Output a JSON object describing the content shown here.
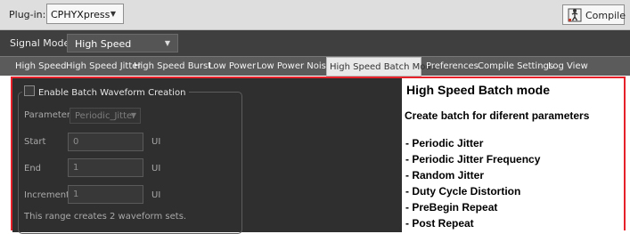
{
  "topbar": {
    "plugin_label": "Plug-in:",
    "plugin_value": "CPHYXpress",
    "compile_label": "Compile"
  },
  "signal": {
    "label": "Signal Mode:",
    "value": "High Speed"
  },
  "tabs": [
    "High Speed",
    "High Speed Jitter",
    "High Speed Burst",
    "Low Power",
    "Low Power Noise",
    "High Speed Batch Mode",
    "Preferences",
    "Compile Settings",
    "Log View"
  ],
  "active_tab_index": 5,
  "batch": {
    "enable_label": "Enable Batch Waveform Creation",
    "enabled": false,
    "parameter_label": "Parameter",
    "parameter_value": "Periodic_Jitter",
    "start_label": "Start",
    "start_value": "0",
    "end_label": "End",
    "end_value": "1",
    "increment_label": "Increment",
    "increment_value": "1",
    "unit": "UI",
    "range_note": "This range creates 2 waveform sets."
  },
  "annotation": {
    "title": "High Speed Batch mode",
    "subtitle": "Create batch for diferent parameters",
    "items": [
      "- Periodic Jitter",
      "- Periodic Jitter Frequency",
      "- Random Jitter",
      "- Duty Cycle Distortion",
      "- PreBegin Repeat",
      "- Post Repeat"
    ],
    "border_color": "#e6212a"
  },
  "icons": {
    "compile": "compile-person-icon",
    "dropdown": "chevron-down-icon"
  }
}
